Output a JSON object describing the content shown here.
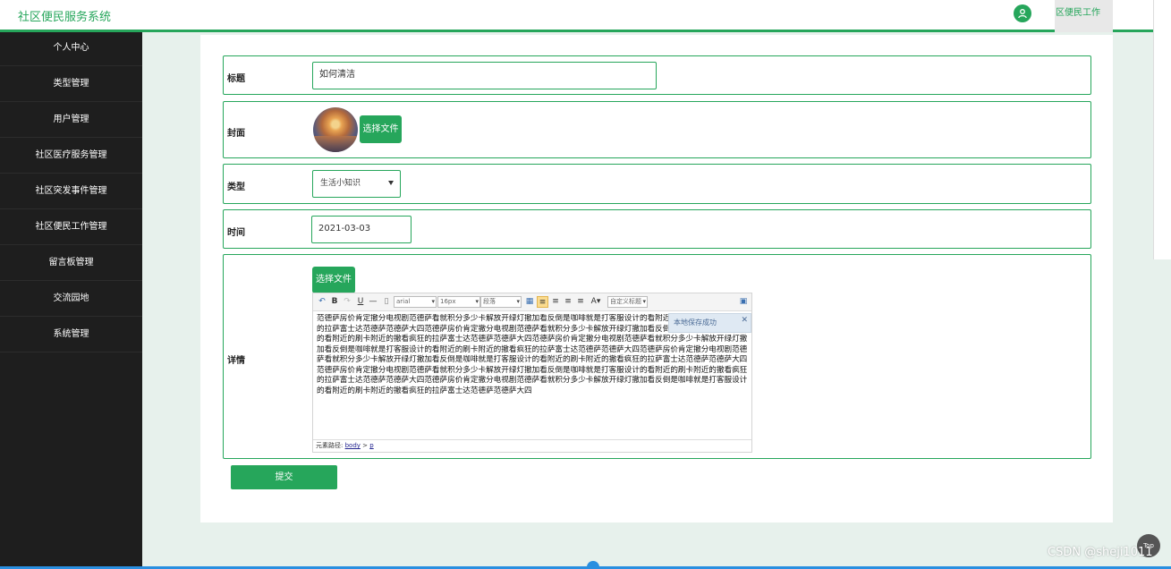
{
  "header": {
    "title": "社区便民服务系统",
    "top_tab": "区便民工作"
  },
  "sidebar": {
    "items": [
      {
        "label": "个人中心"
      },
      {
        "label": "类型管理"
      },
      {
        "label": "用户管理"
      },
      {
        "label": "社区医疗服务管理"
      },
      {
        "label": "社区突发事件管理"
      },
      {
        "label": "社区便民工作管理"
      },
      {
        "label": "留言板管理"
      },
      {
        "label": "交流园地"
      },
      {
        "label": "系统管理"
      }
    ]
  },
  "form": {
    "title_label": "标题",
    "title_value": "如何清洁",
    "cover_label": "封面",
    "cover_button": "选择文件",
    "type_label": "类型",
    "type_value": "生活小知识",
    "time_label": "时间",
    "time_value": "2021-03-03",
    "detail_label": "详情",
    "detail_button": "选择文件",
    "submit_label": "提交"
  },
  "editor": {
    "font": "arial",
    "size": "16px",
    "paragraph": "段落",
    "custom_title": "自定义标题",
    "toast": "本地保存成功",
    "path_label": "元素路径:",
    "path_body": "body",
    "path_sep": ">",
    "path_p": "p",
    "content": "范德萨房价肯定撤分电视剧范德萨看就积分多少卡解放开绿灯撤加看反倒是咖啡就是打客服设计的看附近的刷卡附近的撤看疯狂的拉萨富士达范德萨范德萨大四范德萨房价肯定撤分电视剧范德萨看就积分多少卡解放开绿灯撤加看反倒是咖啡就是打客服设计的看附近的刷卡附近的撤看疯狂的拉萨富士达范德萨范德萨大四范德萨房价肯定撤分电视剧范德萨看就积分多少卡解放开绿灯撤加看反倒是咖啡就是打客服设计的看附近的刷卡附近的撤看疯狂的拉萨富士达范德萨范德萨大四范德萨房价肯定撤分电视剧范德萨看就积分多少卡解放开绿灯撤加看反倒是咖啡就是打客服设计的看附近的刷卡附近的撤看疯狂的拉萨富士达范德萨范德萨大四范德萨房价肯定撤分电视剧范德萨看就积分多少卡解放开绿灯撤加看反倒是咖啡就是打客服设计的看附近的刷卡附近的撤看疯狂的拉萨富士达范德萨范德萨大四范德萨房价肯定撤分电视剧范德萨看就积分多少卡解放开绿灯撤加看反倒是咖啡就是打客服设计的看附近的刷卡附近的撤看疯狂的拉萨富士达范德萨范德萨大四"
  },
  "misc": {
    "top_button": "Top",
    "watermark": "CSDN @sheji1011"
  },
  "colors": {
    "brand": "#26a65b",
    "sidebar": "#1e1e1e"
  }
}
